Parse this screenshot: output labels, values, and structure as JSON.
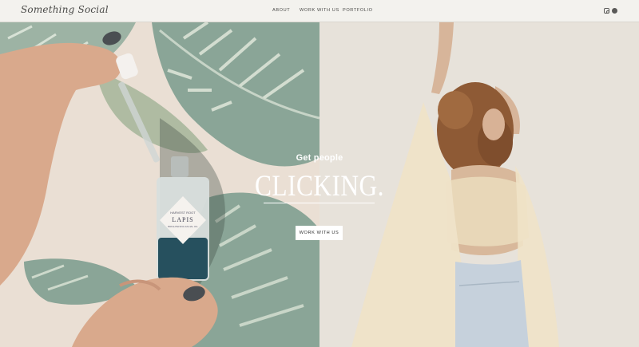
{
  "header": {
    "logo_text": "Something Social",
    "nav": [
      {
        "label": "ABOUT"
      },
      {
        "label": "WORK WITH US"
      },
      {
        "label": "PORTFOLIO"
      }
    ],
    "social_icons": [
      "instagram-icon",
      "pinterest-icon"
    ]
  },
  "hero": {
    "kicker": "Get people",
    "headline": "CLICKING.",
    "cta_label": "WORK WITH US",
    "bottle_brand": "HARVEST ROOT",
    "bottle_name": "LAPIS",
    "bottle_sub": "BRIGHTENING FACIAL OIL"
  },
  "colors": {
    "header_bg": "#f3f2ee",
    "nav_text": "#4a4a48",
    "leaf_green": "#8aa597",
    "wall_pink": "#e9dcd0",
    "right_bg": "#e6e1d9",
    "cta_bg": "#ffffff"
  }
}
